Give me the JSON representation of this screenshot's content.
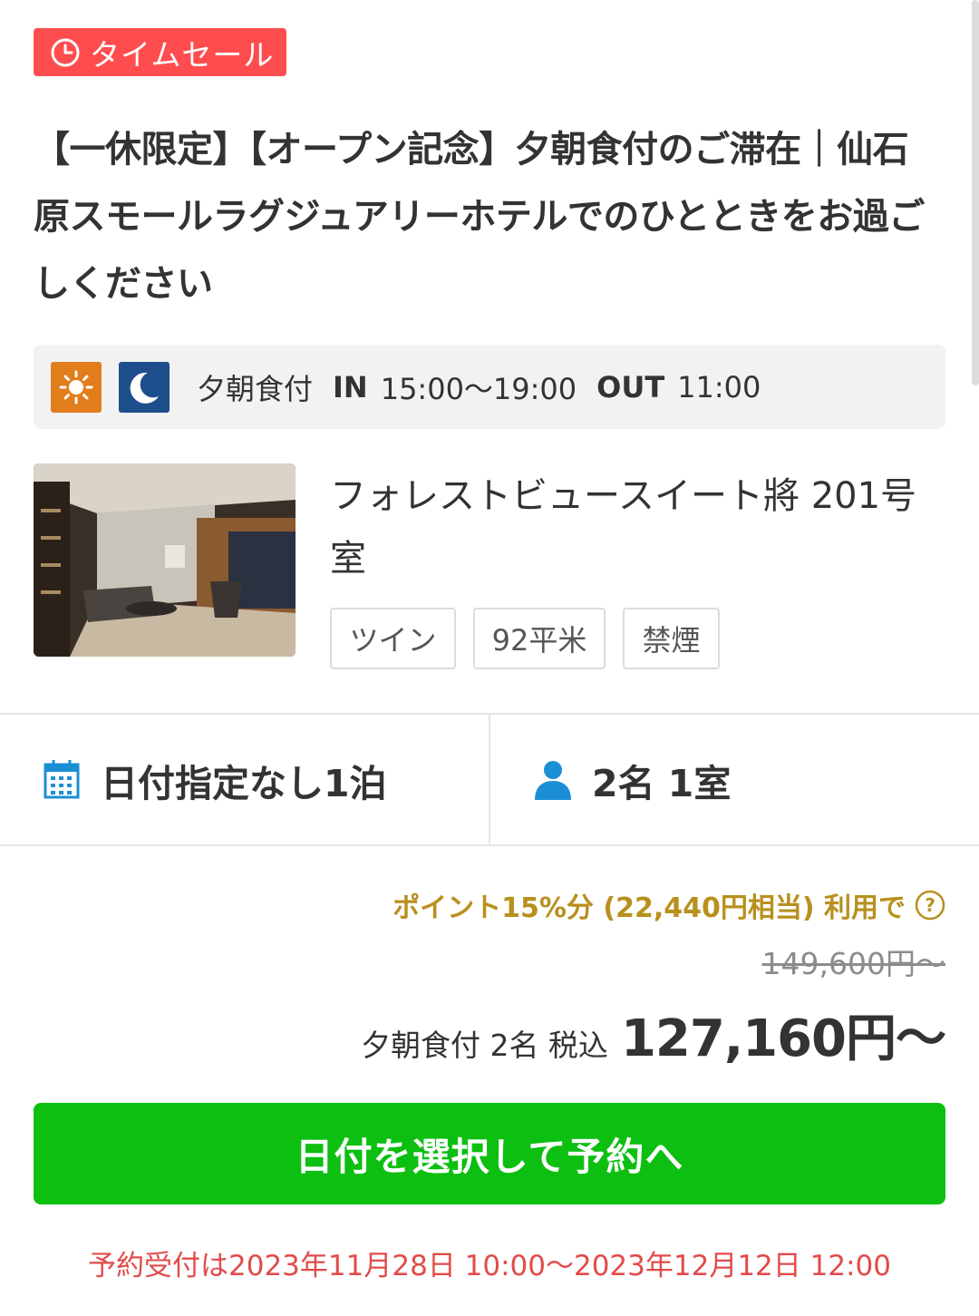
{
  "badge": {
    "label": "タイムセール",
    "icon": "clock-icon",
    "color": "#ff4d4f"
  },
  "plan": {
    "title": "【一休限定】【オープン記念】夕朝食付のご滞在｜仙石原スモールラグジュアリーホテルでのひとときをお過ごしください"
  },
  "meal": {
    "icons": [
      "sun-icon",
      "moon-icon"
    ],
    "label": "夕朝食付",
    "in_label": "IN",
    "in_time": "15:00〜19:00",
    "out_label": "OUT",
    "out_time": "11:00"
  },
  "room": {
    "name": "フォレストビュースイート將 201号室",
    "tags": [
      "ツイン",
      "92平米",
      "禁煙"
    ]
  },
  "conditions": {
    "date_label": "日付指定なし1泊",
    "date_icon": "calendar-icon",
    "guests_label": "2名 1室",
    "guests_icon": "person-icon"
  },
  "pricing": {
    "points_text": "ポイント15%分 (22,440円相当) 利用で",
    "original_price": "149,600円〜",
    "desc": "夕朝食付 2名 税込",
    "price": "127,160円〜"
  },
  "cta": {
    "label": "日付を選択して予約へ",
    "color": "#0dbf11"
  },
  "reservation_period": "予約受付は2023年11月28日 10:00〜2023年12月12日 12:00"
}
